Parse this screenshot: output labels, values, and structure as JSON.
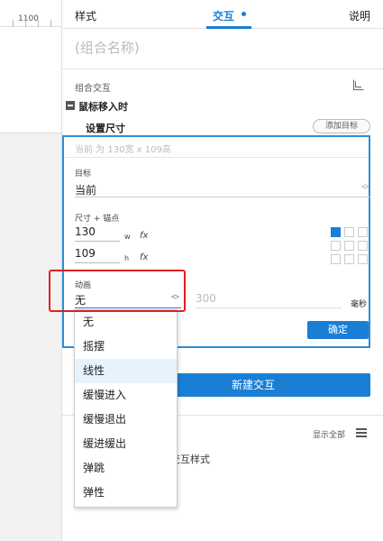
{
  "ruler": {
    "value": "1100"
  },
  "tabs": [
    {
      "label": "样式"
    },
    {
      "label": "交互"
    },
    {
      "label": "说明"
    }
  ],
  "group_name": "(组合名称)",
  "section_title": "组合交互",
  "event": {
    "label": "鼠标移入时"
  },
  "action": {
    "label": "设置尺寸",
    "add_target": "添加目标"
  },
  "config": {
    "header": "当前 为 130宽 x 109高",
    "target_label": "目标",
    "target_value": "当前",
    "size_label": "尺寸 + 锚点",
    "width": "130",
    "width_unit": "w",
    "height": "109",
    "height_unit": "h",
    "fx": "fx",
    "anchor_selected": "top-left",
    "animation_label": "动画",
    "animation_value": "无",
    "duration_value": "300",
    "duration_unit": "毫秒",
    "confirm": "确定"
  },
  "dropdown": {
    "options": [
      "无",
      "摇摆",
      "线性",
      "缓慢进入",
      "缓慢退出",
      "缓进缓出",
      "弹跳",
      "弹性"
    ],
    "hovered": "线性"
  },
  "new_interaction": "新建交互",
  "show_all": "显示全部",
  "partial_text": "交互样式",
  "colors": {
    "accent": "#1a7fd4",
    "highlight": "#e02020"
  }
}
